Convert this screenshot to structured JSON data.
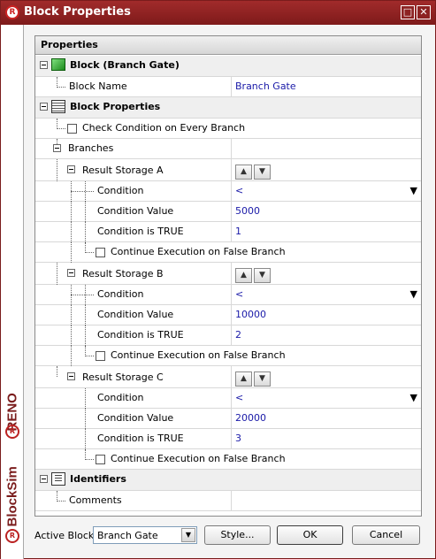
{
  "window": {
    "title": "Block Properties",
    "maximize_glyph": "□",
    "close_glyph": "✕"
  },
  "branding": {
    "reno": "RENO",
    "blocksim": "BlockSim",
    "logo_letter": "R"
  },
  "grid": {
    "header": "Properties",
    "block_category": "Block (Branch Gate)",
    "block_name_label": "Block Name",
    "block_name_value": "Branch Gate",
    "block_properties_category": "Block Properties",
    "check_condition_label": "Check Condition on Every Branch",
    "branches_label": "Branches",
    "storages": [
      {
        "label": "Result Storage A",
        "condition_label": "Condition",
        "condition_value": "<",
        "condition_value_label": "Condition Value",
        "condition_value_value": "5000",
        "condition_true_label": "Condition is TRUE",
        "condition_true_value": "1",
        "continue_label": "Continue Execution on False Branch"
      },
      {
        "label": "Result Storage B",
        "condition_label": "Condition",
        "condition_value": "<",
        "condition_value_label": "Condition Value",
        "condition_value_value": "10000",
        "condition_true_label": "Condition is TRUE",
        "condition_true_value": "2",
        "continue_label": "Continue Execution on False Branch"
      },
      {
        "label": "Result Storage C",
        "condition_label": "Condition",
        "condition_value": "<",
        "condition_value_label": "Condition Value",
        "condition_value_value": "20000",
        "condition_true_label": "Condition is TRUE",
        "condition_true_value": "3",
        "continue_label": "Continue Execution on False Branch"
      }
    ],
    "identifiers_category": "Identifiers",
    "comments_label": "Comments",
    "comments_value": ""
  },
  "glyphs": {
    "up": "▲",
    "down": "▼",
    "dropdown": "▼"
  },
  "bottom": {
    "active_block_label": "Active Block",
    "active_block_value": "Branch Gate",
    "style_button": "Style...",
    "ok_button": "OK",
    "cancel_button": "Cancel"
  }
}
